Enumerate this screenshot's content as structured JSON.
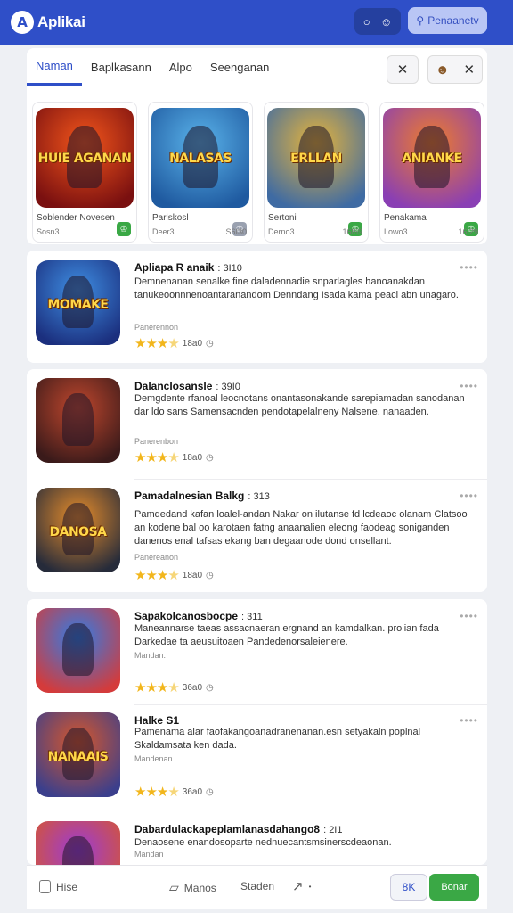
{
  "app": {
    "logo_mark": "A",
    "title": "Aplikai"
  },
  "header": {
    "icon_a": "○",
    "icon_b": "☺",
    "button_label": "Penaanetv",
    "button_icon": "⚲"
  },
  "tabs": [
    {
      "label": "Naman"
    },
    {
      "label": "Baplkasann"
    },
    {
      "label": "Alpo"
    },
    {
      "label": "Seenganan"
    }
  ],
  "tab_actions": {
    "close_1": "✕",
    "avatar": "☻",
    "close_2": "✕"
  },
  "featured": [
    {
      "title": "Soblender Novesen",
      "sub": "Sosn3",
      "count": "",
      "art": "HUIE AGANAN",
      "colors": [
        "#f4561b",
        "#7a1010"
      ],
      "badge": "#3aa845"
    },
    {
      "title": "Parlskosl",
      "sub": "Deer3",
      "count": "S6I30",
      "art": "NALASAS",
      "colors": [
        "#5ab3ea",
        "#1f5aa0"
      ],
      "badge": "#9aa1b0"
    },
    {
      "title": "Sertoni",
      "sub": "Derno3",
      "count": "16I69",
      "art": "ERLLAN",
      "colors": [
        "#e7b43a",
        "#3f6ba3"
      ],
      "badge": "#3aa845"
    },
    {
      "title": "Penakama",
      "sub": "Lowo3",
      "count": "16I29",
      "art": "ANIANKE",
      "colors": [
        "#ef7d2a",
        "#8a3fb4"
      ],
      "badge": "#3aa845"
    }
  ],
  "list": [
    {
      "title": "Apliapa R anaik",
      "num": ": 3I10",
      "desc": "Demnenanan senalke fine daladennadie snparlagles hanoanakdan tanukeoonnnenoantaranandom Denndang Isada kama peacl abn unagaro.",
      "meta": "Panerennon",
      "rating": "18a0",
      "art": "MOMAKE",
      "colors": [
        "#3f8fe3",
        "#1b2f7e"
      ]
    },
    {
      "title": "Dalanclosansle",
      "num": ": 39I0",
      "desc": "Demgdente rfanoal leocnotans onantasonakande sarepiamadan sanodanan dar ldo sans Samensacnden pendotapelalneny Nalsene. nanaaden.",
      "meta": "Panerenbon",
      "rating": "18a0",
      "art": "",
      "colors": [
        "#c0472d",
        "#3a1a1a"
      ]
    },
    {
      "title": "Pamadalnesian Balkg",
      "num": ": 313",
      "desc": "Pamdedand kafan loalel-andan Nakar on ilutanse fd lcdeaoc olanam Clatsoo an kodene bal oo karotaen fatng anaanalien eleong faodeag soniganden danenos enal tafsas ekang ban degaanode dond onsellant.",
      "meta": "Panereanon",
      "rating": "18a0",
      "art": "DANOSA",
      "colors": [
        "#e88d2a",
        "#262b3a"
      ]
    },
    {
      "title": "Sapakolcanosbocpe",
      "num": ": 311",
      "desc": "Maneannarse taeas assacnaeran ergnand an kamdalkan. prolian fada Darkedae ta aeusuitoaen Pandedenorsaleienere.",
      "meta": "Mandan.",
      "rating": "36a0",
      "art": "",
      "colors": [
        "#2e7de8",
        "#d43b3b"
      ]
    },
    {
      "title": "Halke S1",
      "num": "",
      "desc": "Pamenama alar faofakangoanadranenanan.esn setyakaln poplnal Skaldamsata ken dada.",
      "meta": "Mandenan",
      "rating": "36a0",
      "art": "NANAAIS",
      "colors": [
        "#d8572a",
        "#3b3f8c"
      ]
    },
    {
      "title": "Dabardulackapeplamlanasdahango8",
      "num": ": 2I1",
      "desc": "Denaosene enandosoparte nednuecantsmsinerscdeaonan.",
      "meta": "Mandan",
      "rating": "",
      "art": "",
      "colors": [
        "#9b3bd6",
        "#d8572a"
      ]
    }
  ],
  "bottom": {
    "home_label": "Hise",
    "menu_label": "Manos",
    "stadan_label": "Staden",
    "ok_label": "8K",
    "go_label": "Bonar"
  }
}
